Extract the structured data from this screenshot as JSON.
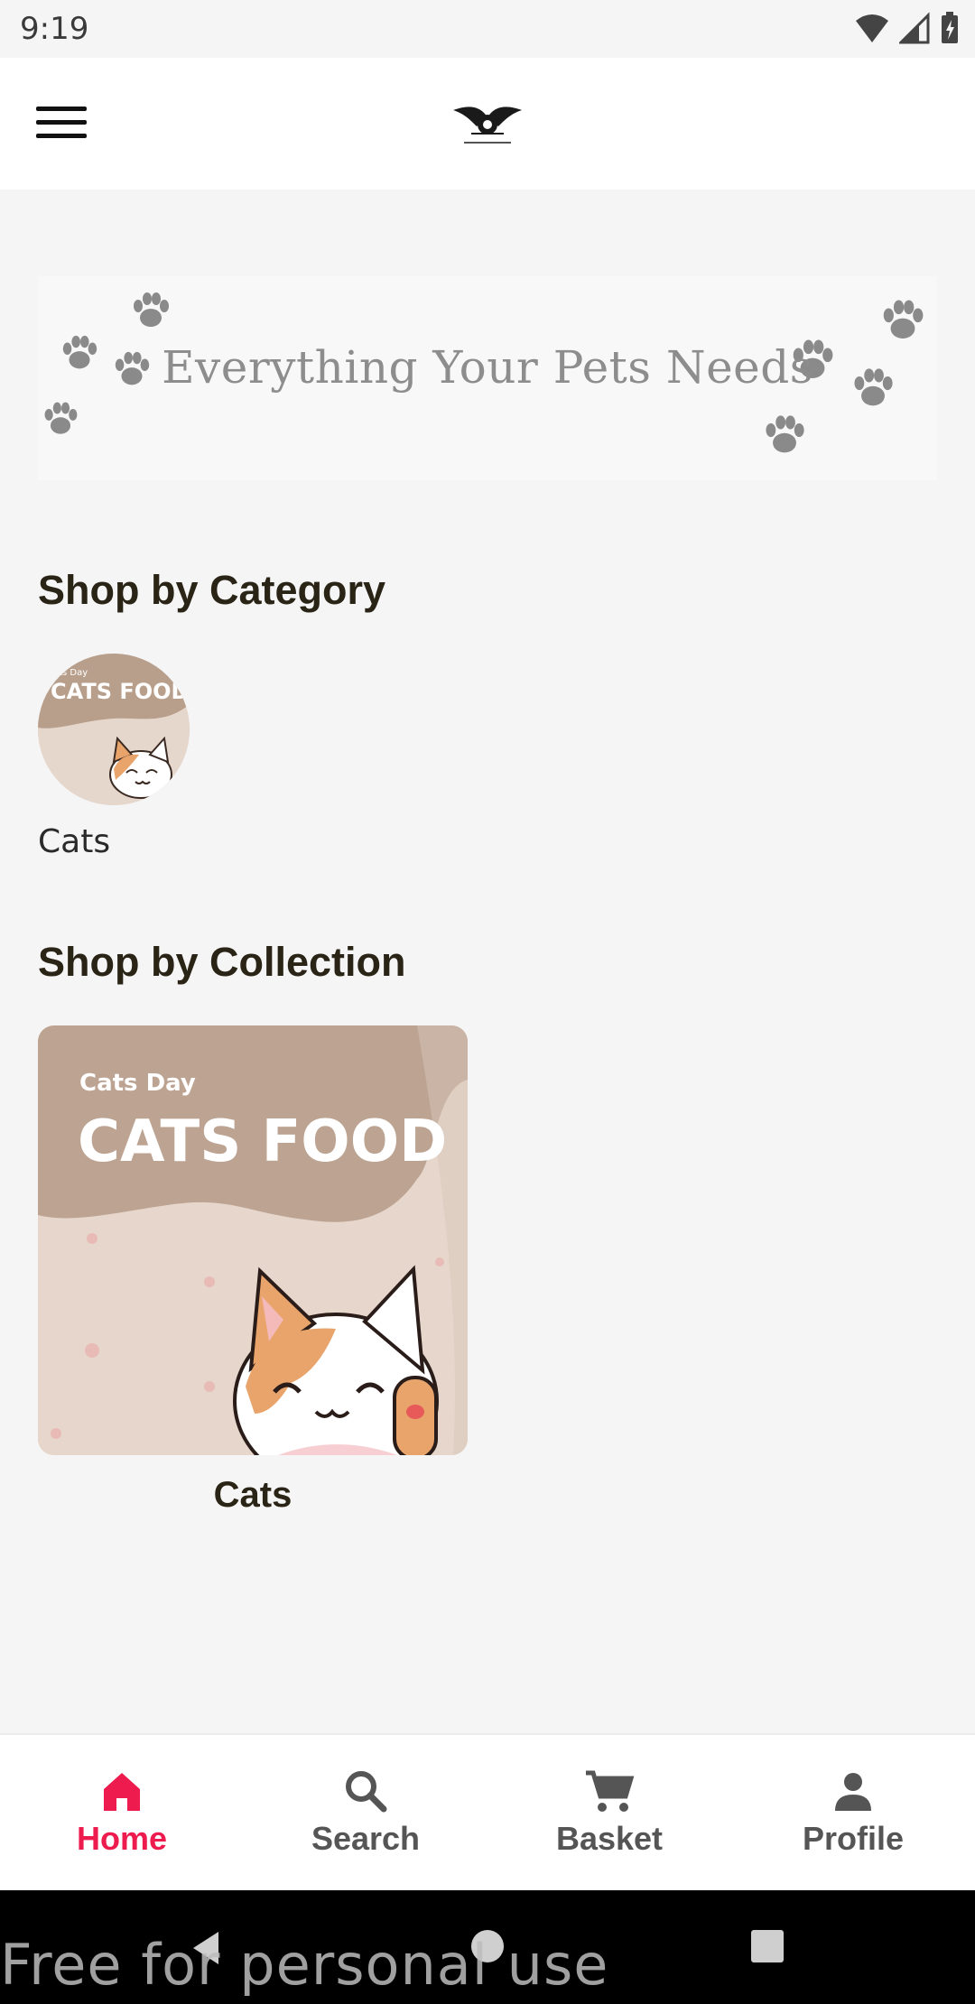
{
  "status_bar": {
    "time": "9:19"
  },
  "banner": {
    "text": "Everything Your Pets Needs"
  },
  "sections": {
    "category_title": "Shop by Category",
    "collection_title": "Shop by Collection"
  },
  "categories": [
    {
      "label": "Cats",
      "image_small_text": "Cats Day",
      "image_title": "CATS FOOD"
    }
  ],
  "collections": [
    {
      "label": "Cats",
      "image_small_text": "Cats Day",
      "image_title": "CATS FOOD"
    }
  ],
  "bottom_nav": {
    "items": [
      {
        "label": "Home",
        "icon": "home-icon",
        "active": true
      },
      {
        "label": "Search",
        "icon": "search-icon",
        "active": false
      },
      {
        "label": "Basket",
        "icon": "cart-icon",
        "active": false
      },
      {
        "label": "Profile",
        "icon": "person-icon",
        "active": false
      }
    ]
  },
  "watermark": "Free for personal use",
  "colors": {
    "accent": "#ee1c4e",
    "inactive": "#555555",
    "background": "#f5f5f5",
    "title_text": "#2a2416"
  }
}
